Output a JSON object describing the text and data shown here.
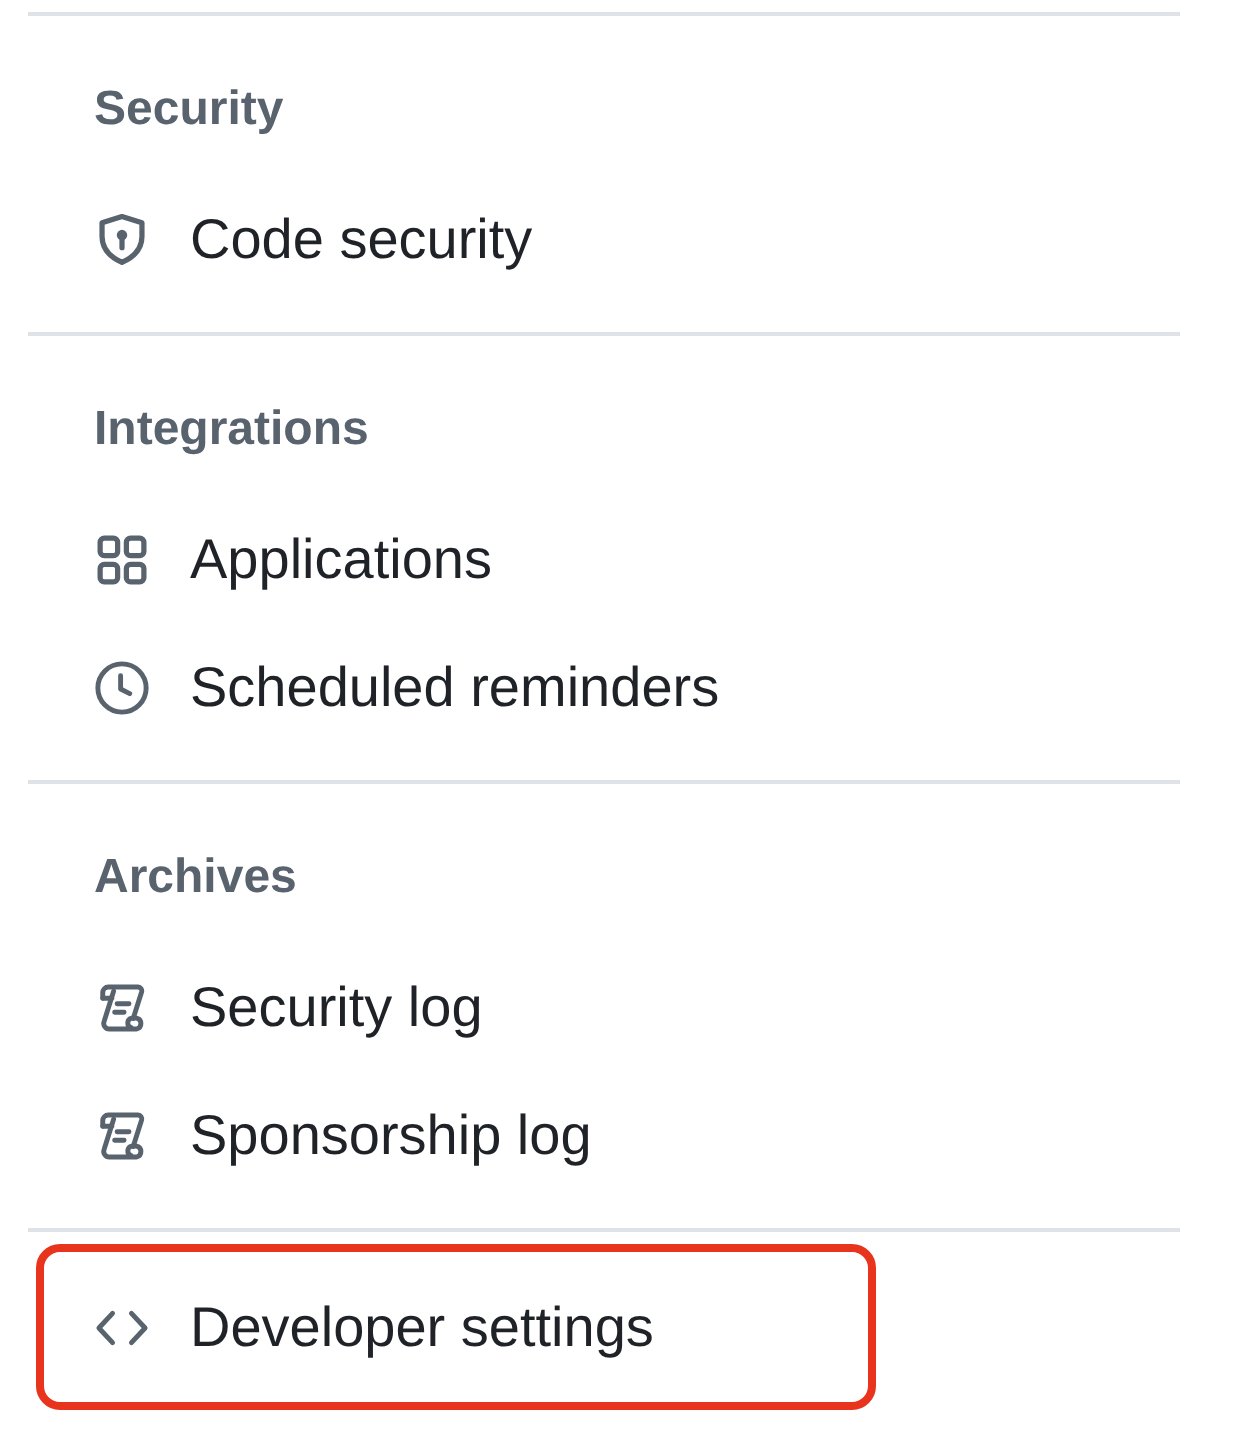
{
  "sections": [
    {
      "heading": "Security",
      "items": [
        {
          "label": "Code security",
          "kind": "shield",
          "highlighted": false
        }
      ]
    },
    {
      "heading": "Integrations",
      "items": [
        {
          "label": "Applications",
          "kind": "apps",
          "highlighted": false
        },
        {
          "label": "Scheduled reminders",
          "kind": "clock",
          "highlighted": false
        }
      ]
    },
    {
      "heading": "Archives",
      "items": [
        {
          "label": "Security log",
          "kind": "log",
          "highlighted": false
        },
        {
          "label": "Sponsorship log",
          "kind": "log",
          "highlighted": false
        }
      ]
    },
    {
      "items": [
        {
          "label": "Developer settings",
          "kind": "code",
          "highlighted": true
        }
      ]
    }
  ]
}
